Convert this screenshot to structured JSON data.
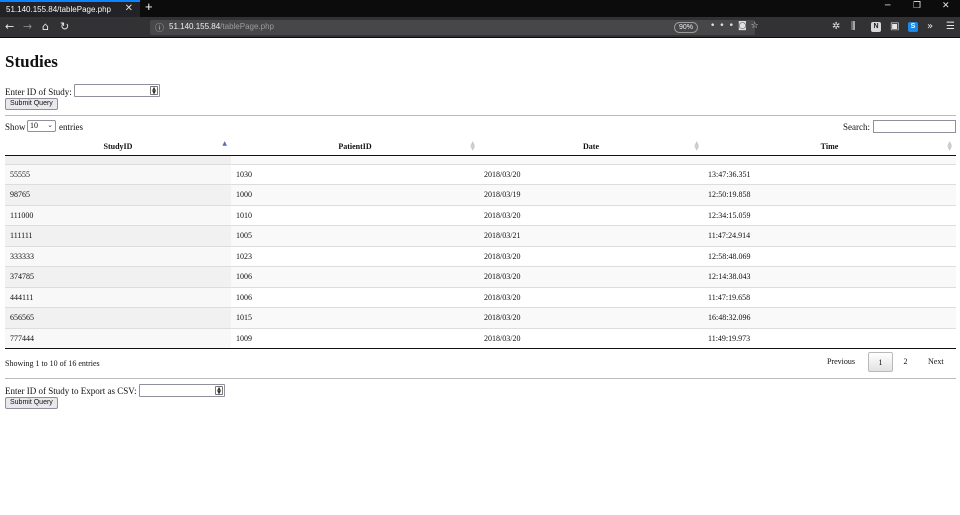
{
  "browser": {
    "tab_title": "51.140.155.84/tablePage.php",
    "tab_close": "✕",
    "new_tab": "+",
    "url_host": "51.140.155.84",
    "url_path": "/tablePage.php",
    "zoom": "90%",
    "window_controls": {
      "minimize": "─",
      "restore": "❐",
      "close": "✕"
    }
  },
  "page": {
    "title": "Studies",
    "study_form": {
      "label": "Enter ID of Study:",
      "value": "",
      "submit": "Submit Query"
    },
    "table_controls": {
      "show_label": "Show",
      "page_length": "10",
      "entries_label": "entries",
      "search_label": "Search:",
      "search_value": ""
    },
    "table": {
      "columns": [
        "StudyID",
        "PatientID",
        "Date",
        "Time"
      ],
      "sort_column": "StudyID",
      "rows": [
        [
          "55555",
          "1030",
          "2018/03/20",
          "13:47:36.351"
        ],
        [
          "98765",
          "1000",
          "2018/03/19",
          "12:50:19.858"
        ],
        [
          "111000",
          "1010",
          "2018/03/20",
          "12:34:15.059"
        ],
        [
          "111111",
          "1005",
          "2018/03/21",
          "11:47:24.914"
        ],
        [
          "333333",
          "1023",
          "2018/03/20",
          "12:58:48.069"
        ],
        [
          "374785",
          "1006",
          "2018/03/20",
          "12:14:38.043"
        ],
        [
          "444111",
          "1006",
          "2018/03/20",
          "11:47:19.658"
        ],
        [
          "656565",
          "1015",
          "2018/03/20",
          "16:48:32.096"
        ],
        [
          "777444",
          "1009",
          "2018/03/20",
          "11:49:19.973"
        ]
      ]
    },
    "info": "Showing 1 to 10 of 16 entries",
    "pagination": {
      "previous": "Previous",
      "pages": [
        "1",
        "2"
      ],
      "current": "1",
      "next": "Next"
    },
    "export_form": {
      "label": "Enter ID of Study to Export as CSV:",
      "value": "",
      "submit": "Submit Query"
    }
  }
}
